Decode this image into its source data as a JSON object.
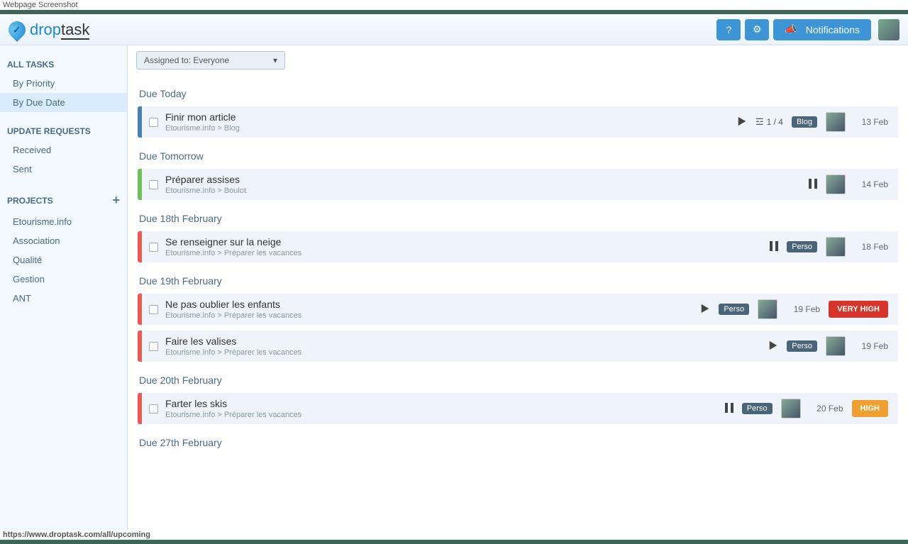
{
  "meta": {
    "screenshot_label": "Webpage Screenshot",
    "status_url": "https://www.droptask.com/all/upcoming"
  },
  "header": {
    "logo_light": "drop",
    "logo_bold": "task",
    "help_label": "?",
    "notifications_label": "Notifications"
  },
  "sidebar": {
    "all_tasks_head": "ALL TASKS",
    "all_tasks": [
      {
        "label": "By Priority",
        "active": false
      },
      {
        "label": "By Due Date",
        "active": true
      }
    ],
    "update_head": "UPDATE REQUESTS",
    "updates": [
      {
        "label": "Received"
      },
      {
        "label": "Sent"
      }
    ],
    "projects_head": "PROJECTS",
    "projects": [
      {
        "label": "Etourisme.info"
      },
      {
        "label": "Association"
      },
      {
        "label": "Qualité"
      },
      {
        "label": "Gestion"
      },
      {
        "label": "ANT"
      }
    ]
  },
  "filter": {
    "label": "Assigned to: Everyone"
  },
  "sections": [
    {
      "title": "Due Today",
      "tasks": [
        {
          "stripe": "blue",
          "title": "Finir mon article",
          "sub": "Etourisme.info > Blog",
          "play": true,
          "pause": false,
          "subtasks": "1 / 4",
          "tag": "Blog",
          "avatar": true,
          "date": "13 Feb",
          "priority": null
        }
      ]
    },
    {
      "title": "Due Tomorrow",
      "tasks": [
        {
          "stripe": "green",
          "title": "Préparer assises",
          "sub": "Etourisme.info > Boulot",
          "play": false,
          "pause": true,
          "subtasks": null,
          "tag": null,
          "avatar": true,
          "date": "14 Feb",
          "priority": null
        }
      ]
    },
    {
      "title": "Due 18th February",
      "tasks": [
        {
          "stripe": "red",
          "title": "Se renseigner sur la neige",
          "sub": "Etourisme.info > Préparer les vacances",
          "play": false,
          "pause": true,
          "subtasks": null,
          "tag": "Perso",
          "avatar": true,
          "date": "18 Feb",
          "priority": null
        }
      ]
    },
    {
      "title": "Due 19th February",
      "tasks": [
        {
          "stripe": "red",
          "title": "Ne pas oublier les enfants",
          "sub": "Etourisme.info > Préparer les vacances",
          "play": true,
          "pause": false,
          "subtasks": null,
          "tag": "Perso",
          "avatar": true,
          "date": "19 Feb",
          "priority": "VERY HIGH"
        },
        {
          "stripe": "red",
          "title": "Faire les valises",
          "sub": "Etourisme.info > Préparer les vacances",
          "play": true,
          "pause": false,
          "subtasks": null,
          "tag": "Perso",
          "avatar": true,
          "date": "19 Feb",
          "priority": null
        }
      ]
    },
    {
      "title": "Due 20th February",
      "tasks": [
        {
          "stripe": "red",
          "title": "Farter les skis",
          "sub": "Etourisme.info > Préparer les vacances",
          "play": false,
          "pause": true,
          "subtasks": null,
          "tag": "Perso",
          "avatar": true,
          "date": "20 Feb",
          "priority": "HIGH"
        }
      ]
    },
    {
      "title": "Due 27th February",
      "tasks": []
    }
  ]
}
